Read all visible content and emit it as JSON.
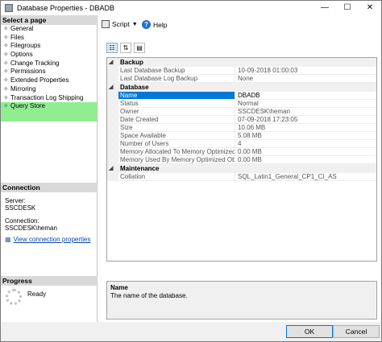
{
  "window": {
    "title": "Database Properties - DBADB"
  },
  "left": {
    "select_page_header": "Select a page",
    "pages": [
      "General",
      "Files",
      "Filegroups",
      "Options",
      "Change Tracking",
      "Permissions",
      "Extended Properties",
      "Mirroring",
      "Transaction Log Shipping",
      "Query Store"
    ],
    "selected_page": "Query Store",
    "connection_header": "Connection",
    "server_label": "Server:",
    "server_value": "SSCDESK",
    "connection_label": "Connection:",
    "connection_value": "SSCDESK\\heman",
    "view_link": "View connection properties",
    "progress_header": "Progress",
    "progress_status": "Ready"
  },
  "toolbar": {
    "script_label": "Script",
    "help_label": "Help"
  },
  "grid": {
    "backup_cat": "Backup",
    "last_backup_k": "Last Database Backup",
    "last_backup_v": "10-09-2018 01:00:03",
    "last_log_k": "Last Database Log Backup",
    "last_log_v": "None",
    "database_cat": "Database",
    "name_k": "Name",
    "name_v": "DBADB",
    "status_k": "Status",
    "status_v": "Normal",
    "owner_k": "Owner",
    "owner_v": "SSCDESK\\heman",
    "created_k": "Date Created",
    "created_v": "07-09-2018 17:23:05",
    "size_k": "Size",
    "size_v": "10.06 MB",
    "space_k": "Space Available",
    "space_v": "5.08 MB",
    "users_k": "Number of Users",
    "users_v": "4",
    "mem_alloc_k": "Memory Allocated To Memory Optimized Objects",
    "mem_alloc_v": "0.00 MB",
    "mem_used_k": "Memory Used By Memory Optimized Objects",
    "mem_used_v": "0.00 MB",
    "maintenance_cat": "Maintenance",
    "collation_k": "Collation",
    "collation_v": "SQL_Latin1_General_CP1_CI_AS"
  },
  "description": {
    "title": "Name",
    "text": "The name of the database."
  },
  "buttons": {
    "ok": "OK",
    "cancel": "Cancel"
  },
  "colors": {
    "selected_page_bg": "#90ee90",
    "selected_row_bg": "#0078d7"
  }
}
